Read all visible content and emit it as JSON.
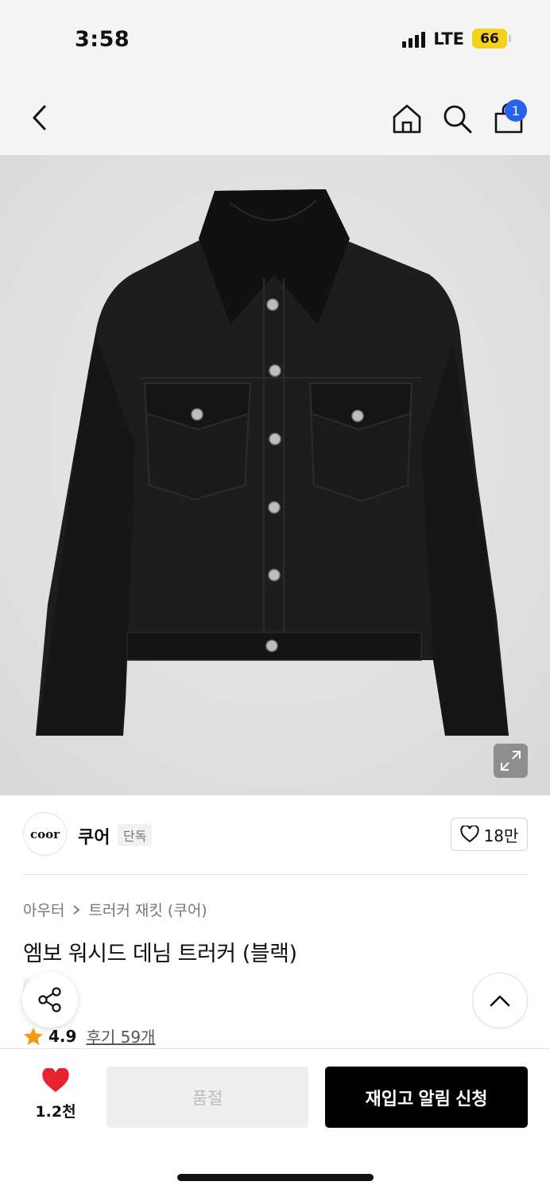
{
  "status_bar": {
    "time": "3:58",
    "network": "LTE",
    "battery": "66"
  },
  "nav": {
    "cart_count": "1"
  },
  "brand": {
    "logo_text": "coor",
    "name": "쿠어",
    "tag": "단독",
    "likes": "18만"
  },
  "breadcrumb": {
    "items": [
      "아우터",
      "트러커 재킷 (쿠어)"
    ]
  },
  "product": {
    "title": "엠보 워시드 데님 트러커 (블랙)",
    "tag": "단독",
    "rating": "4.9",
    "review_link": "후기 59개"
  },
  "bottom_bar": {
    "wish_count": "1.2천",
    "soldout_label": "품절",
    "restock_label": "재입고 알림 신청"
  },
  "colors": {
    "accent": "#2563eb",
    "heart": "#e8212f",
    "star": "#f39c12",
    "battery": "#f5d11a"
  }
}
